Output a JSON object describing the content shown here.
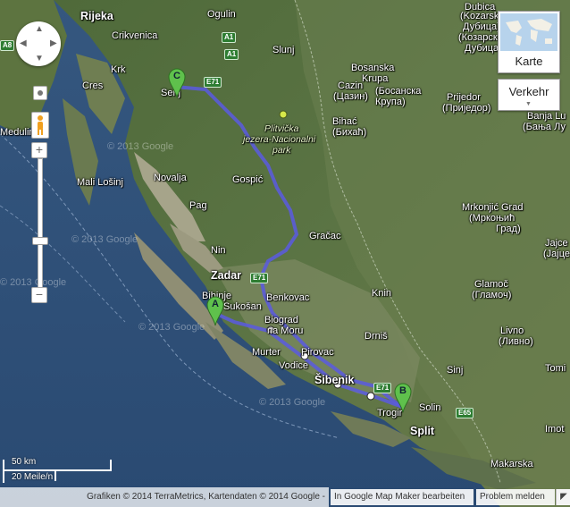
{
  "controls": {
    "map_type_label": "Karte",
    "traffic_label": "Verkehr",
    "scale_metric": "50 km",
    "scale_imperial": "20 Meile/n"
  },
  "footer": {
    "attribution": "Grafiken © 2014 TerraMetrics, Kartendaten © 2014 Google -",
    "map_maker_link": "In Google Map Maker bearbeiten",
    "report_problem": "Problem melden"
  },
  "markers": {
    "a": "A",
    "b": "B",
    "c": "C"
  },
  "labels": {
    "rijeka": "Rijeka",
    "ogulin": "Ogulin",
    "crikvenica": "Crikvenica",
    "krk": "Krk",
    "cres": "Cres",
    "senj": "Senj",
    "slunj": "Slunj",
    "cazin": "Cazin",
    "cazin_cyr": "(Цазин)",
    "bosanska_krupa": "Bosanska",
    "bosanska_krupa_2": "Krupa",
    "bosanska_krupa_cyr": "(Босанска",
    "bosanska_krupa_cyr_2": "Крупа)",
    "plitvice": "Plitvička",
    "plitvice_2": "jezera-Nacionalni",
    "plitvice_3": "park",
    "bihac": "Bihać",
    "bihac_cyr": "(Бихаћ)",
    "prijedor": "Prijedor",
    "prijedor_cyr": "(Приједор)",
    "banja_luka": "Banja Lu",
    "banja_luka_cyr": "(Бања Лу",
    "dubica": "Dubica",
    "kozarska": "(Kozarsk",
    "dubica_cyr": "Дубица)",
    "kozarska_cyr": "(Козарска",
    "dubica_cyr_2": "Дубица)",
    "medulin": "Medulin",
    "mali_losinj": "Mali Lošinj",
    "novalja": "Novalja",
    "pag": "Pag",
    "gospic": "Gospić",
    "gracac": "Gračac",
    "mrkonjic": "Mrkonjić Grad",
    "mrkonjic_cyr": "(Мркоњић",
    "mrkonjic_cyr_2": "Град)",
    "jajce": "Jajce",
    "jajce_cyr": "(Јајце",
    "nin": "Nin",
    "zadar": "Zadar",
    "benkovac": "Benkovac",
    "bibinje": "Bibinje",
    "sukosan": "Sukošan",
    "knin": "Knin",
    "glamoc": "Glamoč",
    "glamoc_cyr": "(Гламоч)",
    "biograd": "Biograd",
    "biograd_2": "na Moru",
    "drnis": "Drniš",
    "livno": "Livno",
    "livno_cyr": "(Ливно)",
    "murter": "Murter",
    "pirovac": "Pirovac",
    "vodice": "Vodice",
    "sibenik": "Šibenik",
    "sinj": "Sinj",
    "tomislavgrad": "Tomi",
    "trogir": "Trogir",
    "solin": "Solin",
    "split": "Split",
    "imotski": "Imot",
    "makarska": "Makarska",
    "watermark_1": "© 2013 Google",
    "watermark_2": "© 2013 Google",
    "watermark_3": "© 2013 Google",
    "watermark_4": "© 2013 Google",
    "watermark_5": "© 2013 Google"
  },
  "roads": {
    "a1": "A1",
    "a1b": "A1",
    "e71": "E71",
    "e71b": "E71",
    "a8": "A8",
    "e65": "E65",
    "e71c": "E71"
  }
}
